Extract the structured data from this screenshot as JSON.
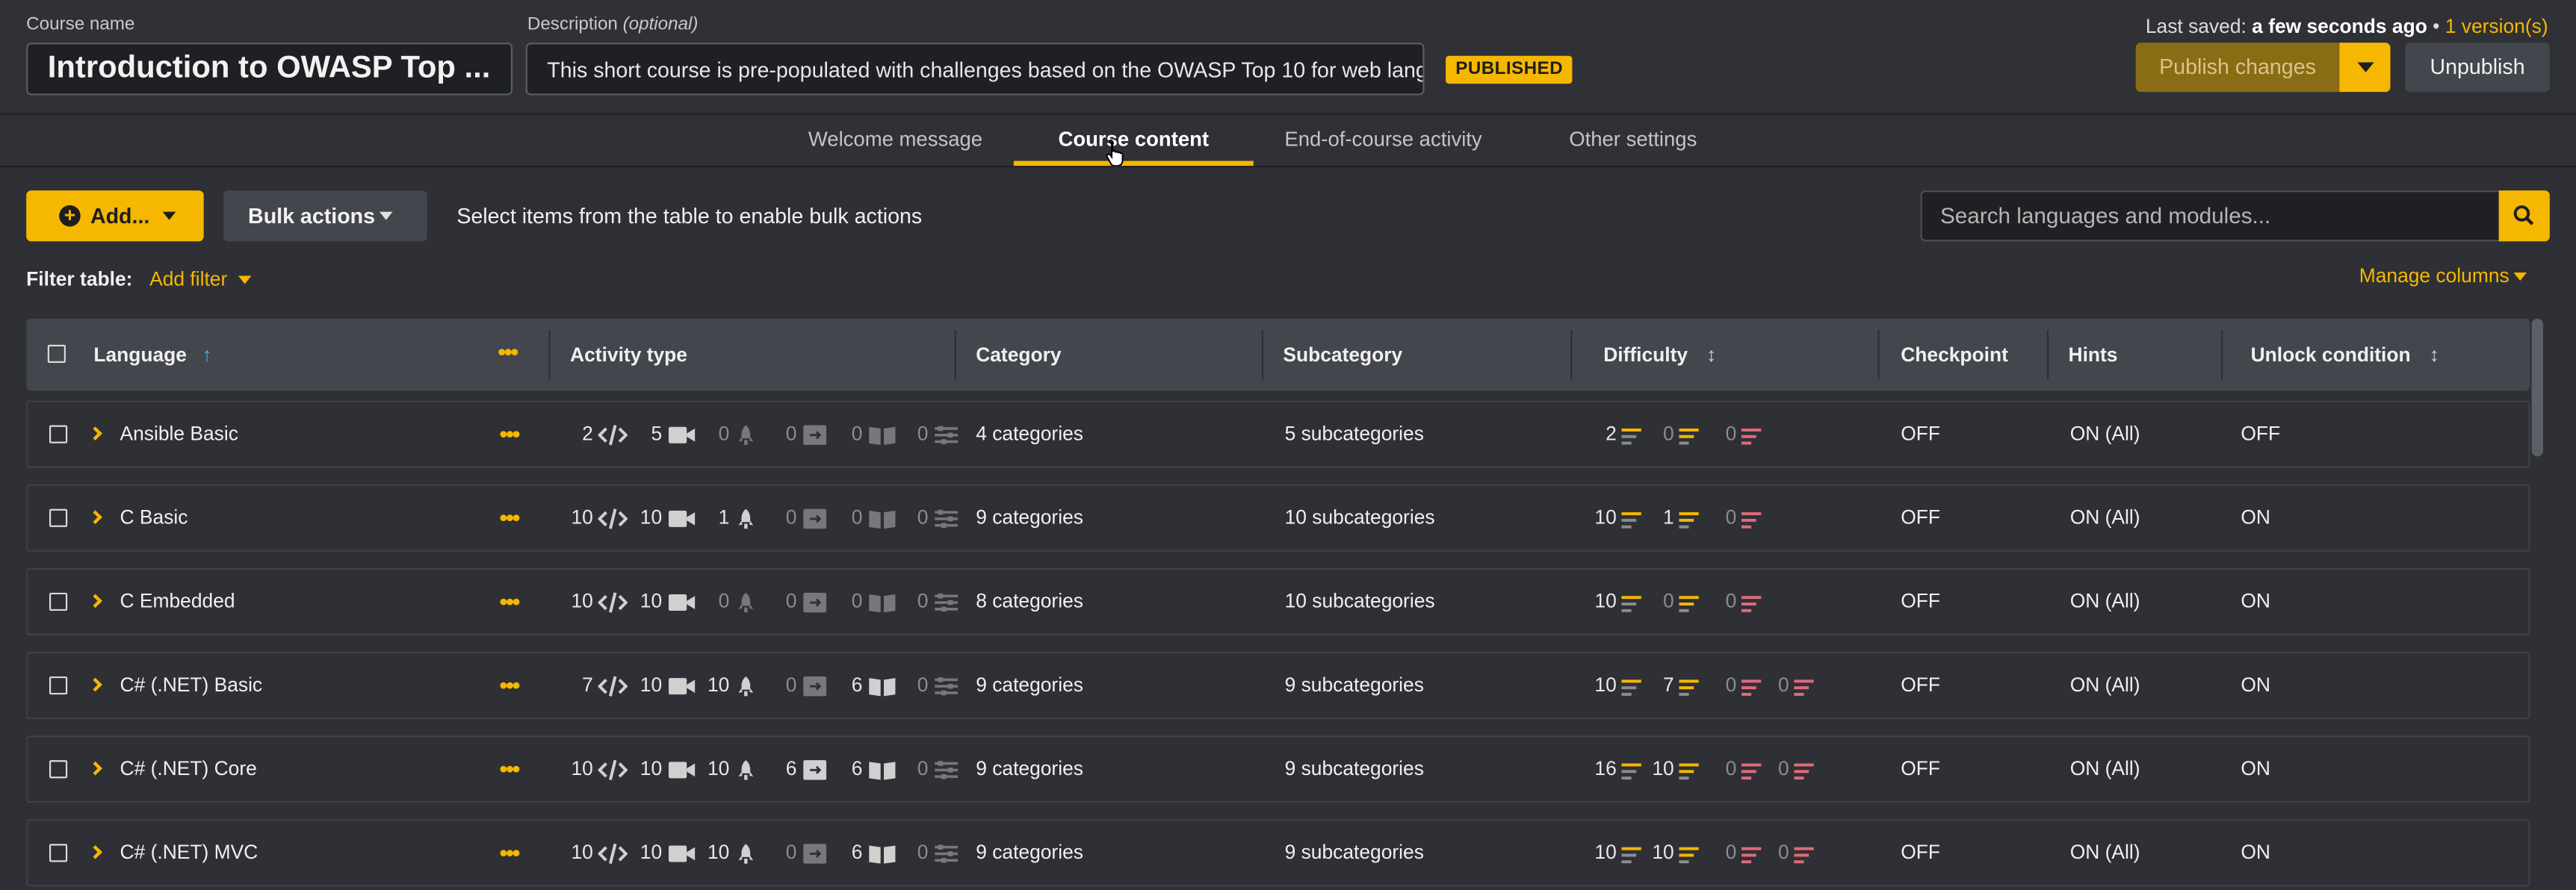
{
  "header": {
    "course_name_label": "Course name",
    "course_name_value": "Introduction to OWASP Top ...",
    "description_label": "Description",
    "description_optional": "(optional)",
    "description_value": "This short course is pre-populated with challenges based on the OWASP Top 10 for web lang...",
    "status_badge": "PUBLISHED",
    "last_saved_prefix": "Last saved:",
    "last_saved_value": "a few seconds ago",
    "separator": "•",
    "versions": "1 version(s)",
    "publish_label": "Publish changes",
    "unpublish_label": "Unpublish"
  },
  "tabs": [
    "Welcome message",
    "Course content",
    "End-of-course activity",
    "Other settings"
  ],
  "active_tab": "Course content",
  "toolbar": {
    "add_label": "Add...",
    "bulk_label": "Bulk actions",
    "bulk_hint": "Select items from the table to enable bulk actions",
    "search_placeholder": "Search languages and modules...",
    "filter_label": "Filter table:",
    "add_filter_label": "Add filter",
    "manage_columns_label": "Manage columns"
  },
  "table": {
    "columns": {
      "language": "Language",
      "activity_type": "Activity type",
      "category": "Category",
      "subcategory": "Subcategory",
      "difficulty": "Difficulty",
      "checkpoint": "Checkpoint",
      "hints": "Hints",
      "unlock_condition": "Unlock condition"
    },
    "rows": [
      {
        "language": "Ansible Basic",
        "activity": [
          2,
          5,
          0,
          0,
          0,
          0
        ],
        "category": "4 categories",
        "subcategory": "5 subcategories",
        "difficulty": [
          2,
          0,
          0
        ],
        "checkpoint": "OFF",
        "hints": "ON (All)",
        "unlock": "OFF"
      },
      {
        "language": "C Basic",
        "activity": [
          10,
          10,
          1,
          0,
          0,
          0
        ],
        "category": "9 categories",
        "subcategory": "10 subcategories",
        "difficulty": [
          10,
          1,
          0
        ],
        "checkpoint": "OFF",
        "hints": "ON (All)",
        "unlock": "ON"
      },
      {
        "language": "C Embedded",
        "activity": [
          10,
          10,
          0,
          0,
          0,
          0
        ],
        "category": "8 categories",
        "subcategory": "10 subcategories",
        "difficulty": [
          10,
          0,
          0
        ],
        "checkpoint": "OFF",
        "hints": "ON (All)",
        "unlock": "ON"
      },
      {
        "language": "C# (.NET) Basic",
        "activity": [
          7,
          10,
          10,
          0,
          6,
          0
        ],
        "category": "9 categories",
        "subcategory": "9 subcategories",
        "difficulty": [
          10,
          7,
          0,
          0
        ],
        "checkpoint": "OFF",
        "hints": "ON (All)",
        "unlock": "ON"
      },
      {
        "language": "C# (.NET) Core",
        "activity": [
          10,
          10,
          10,
          6,
          6,
          0
        ],
        "category": "9 categories",
        "subcategory": "9 subcategories",
        "difficulty": [
          16,
          10,
          0,
          0
        ],
        "checkpoint": "OFF",
        "hints": "ON (All)",
        "unlock": "ON"
      },
      {
        "language": "C# (.NET) MVC",
        "activity": [
          10,
          10,
          10,
          0,
          6,
          0
        ],
        "category": "9 categories",
        "subcategory": "9 subcategories",
        "difficulty": [
          10,
          10,
          0,
          0
        ],
        "checkpoint": "OFF",
        "hints": "ON (All)",
        "unlock": "ON"
      }
    ]
  },
  "colors": {
    "accent": "#f5b700",
    "bg": "#2e3035",
    "header_bg": "#43464d",
    "easy": "#f5b700",
    "medium": "#f5b700",
    "hard": "#e06a7a"
  }
}
